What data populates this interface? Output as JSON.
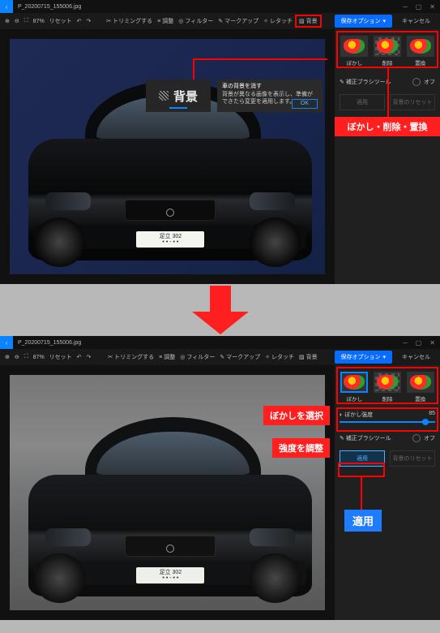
{
  "file_name": "P_20200715_155006.jpg",
  "win_ctl": {
    "min": "─",
    "max": "▢",
    "close": "✕",
    "back": "‹"
  },
  "zoom": {
    "pct": "87%",
    "pct2": "87%",
    "reset": "リセット"
  },
  "tools": {
    "trimming": "トリミングする",
    "adjust": "調整",
    "filter": "フィルター",
    "markup": "マークアップ",
    "retouch": "レタッチ",
    "background": "背景"
  },
  "save": "保存オプション",
  "cancel": "キャンセル",
  "popup_label": "背景",
  "help": {
    "title": "車の背景を消す",
    "body": "背景が異なる画像を表示し、準備ができたら変更を適用します。",
    "ok": "OK"
  },
  "thumbs": {
    "t1": "ぼかし",
    "t2": "削除",
    "t3": "置換"
  },
  "brush_tool": "補正ブラシツール",
  "toggle_off": "オフ",
  "apply": "適用",
  "reset_bg": "背景のリセット",
  "callout_modes": "ぼかし・削除・置換",
  "callout_sel": "ぼかしを選択",
  "callout_strength": "強度を調整",
  "callout_apply": "適用",
  "slider_label": "ぼかし強度",
  "slider_val": "85",
  "plate_top": "足立 302",
  "plate_bot": "• • - • •"
}
